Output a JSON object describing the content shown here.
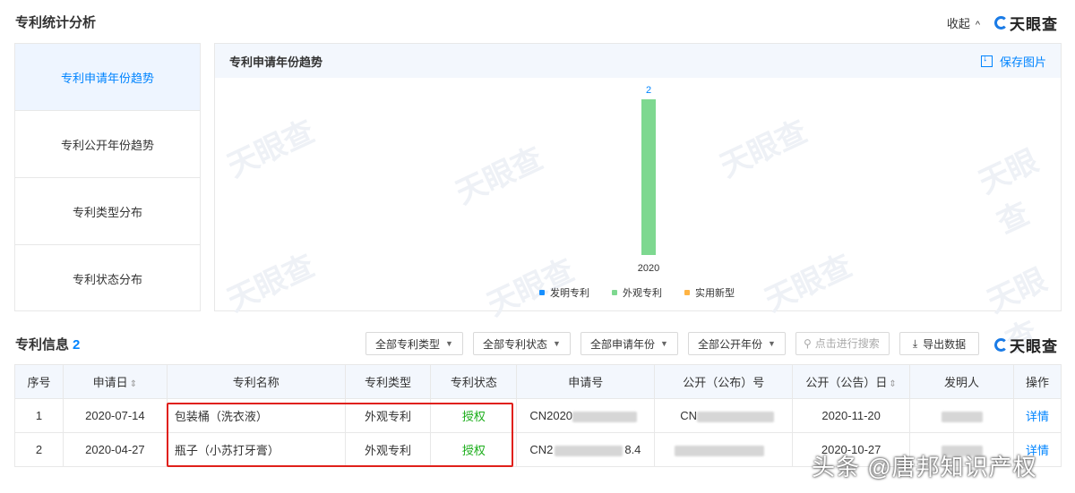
{
  "header": {
    "title": "专利统计分析",
    "collapse_label": "收起",
    "brand": "天眼查"
  },
  "side_tabs": [
    {
      "label": "专利申请年份趋势",
      "active": true
    },
    {
      "label": "专利公开年份趋势",
      "active": false
    },
    {
      "label": "专利类型分布",
      "active": false
    },
    {
      "label": "专利状态分布",
      "active": false
    }
  ],
  "panel": {
    "title": "专利申请年份趋势",
    "save_label": "保存图片"
  },
  "chart_data": {
    "type": "bar",
    "title": "",
    "categories": [
      "2020"
    ],
    "series": [
      {
        "name": "发明专利",
        "color": "#1890ff",
        "values": [
          0
        ]
      },
      {
        "name": "外观专利",
        "color": "#7ed890",
        "values": [
          2
        ]
      },
      {
        "name": "实用新型",
        "color": "#ffb444",
        "values": [
          0
        ]
      }
    ],
    "data_labels": [
      "2"
    ],
    "ylim": [
      0,
      2
    ],
    "grid": false,
    "legend_position": "bottom"
  },
  "info": {
    "title": "专利信息",
    "count": "2",
    "filters": [
      "全部专利类型",
      "全部专利状态",
      "全部申请年份",
      "全部公开年份"
    ],
    "search_placeholder": "点击进行搜索",
    "export_label": "导出数据",
    "brand": "天眼查"
  },
  "table": {
    "headers": [
      "序号",
      "申请日",
      "专利名称",
      "专利类型",
      "专利状态",
      "申请号",
      "公开（公布）号",
      "公开（公告）日",
      "发明人",
      "操作"
    ],
    "sortable": [
      false,
      true,
      false,
      false,
      false,
      false,
      false,
      true,
      false,
      false
    ],
    "rows": [
      {
        "no": "1",
        "apply_date": "2020-07-14",
        "name": "包装桶（洗衣液）",
        "type": "外观专利",
        "status": "授权",
        "app_no_prefix": "CN2020",
        "app_no_suffix": "",
        "pub_no_prefix": "CN",
        "pub_date": "2020-11-20",
        "action": "详情"
      },
      {
        "no": "2",
        "apply_date": "2020-04-27",
        "name": "瓶子（小苏打牙膏）",
        "type": "外观专利",
        "status": "授权",
        "app_no_prefix": "CN2",
        "app_no_suffix": "8.4",
        "pub_no_prefix": "",
        "pub_date": "2020-10-27",
        "action": "详情"
      }
    ]
  },
  "overlay_watermark": "头条 @唐邦知识产权",
  "colors": {
    "accent": "#0084ff",
    "status_granted": "#1aad19",
    "highlight_box": "#e0201a"
  }
}
